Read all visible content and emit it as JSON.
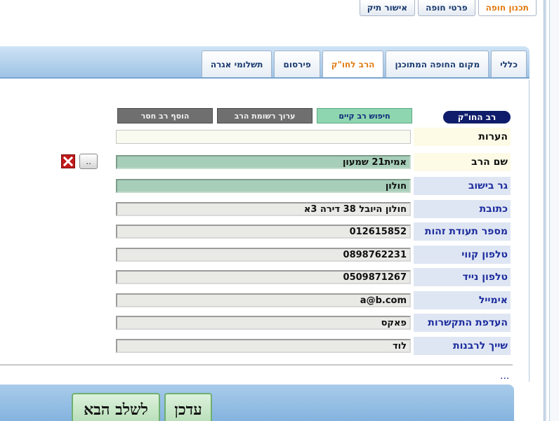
{
  "top_tabs": [
    {
      "label": "תכנון חופה",
      "active": true
    },
    {
      "label": "פרטי חופה",
      "active": false
    },
    {
      "label": "אישור תיק",
      "active": false
    }
  ],
  "sub_tabs": [
    {
      "label": "כללי",
      "active": false
    },
    {
      "label": "מקום החופה המתוכנן",
      "active": false
    },
    {
      "label": "הרב לחו\"ק",
      "active": true
    },
    {
      "label": "פירסום",
      "active": false
    },
    {
      "label": "תשלומי אגרה",
      "active": false
    }
  ],
  "section": {
    "title": "רב החו\"ק"
  },
  "actions": {
    "search": "חיפוש רב קיים",
    "edit_list": "ערוך רשומת הרב",
    "add_missing": "הוסף רב חסר"
  },
  "rows": [
    {
      "label": "הערות",
      "value": ""
    },
    {
      "label": "שם הרב",
      "value": "אמית21 שמעון"
    },
    {
      "label": "גר בישוב",
      "value": "חולון"
    },
    {
      "label": "כתובת",
      "value": "חולון  היובל 38 דירה 3א"
    },
    {
      "label": "מספר תעודת זהות",
      "value": "012615852"
    },
    {
      "label": "טלפון קווי",
      "value": "0898762231"
    },
    {
      "label": "טלפון נייד",
      "value": "0509871267"
    },
    {
      "label": "אימייל",
      "value": "a@b.com"
    },
    {
      "label": "העדפת התקשרות",
      "value": "פאקס"
    },
    {
      "label": "שייך לרבנות",
      "value": "לוד"
    }
  ],
  "name_row_button": "..",
  "ellipsis": "...",
  "footer": {
    "update": "עדכן",
    "next": "לשלב הבא"
  },
  "colors": {
    "accent": "#e07a10",
    "label_blue": "#1d2d9e",
    "badge": "#0f1c6b",
    "delete": "#c21a1a"
  }
}
